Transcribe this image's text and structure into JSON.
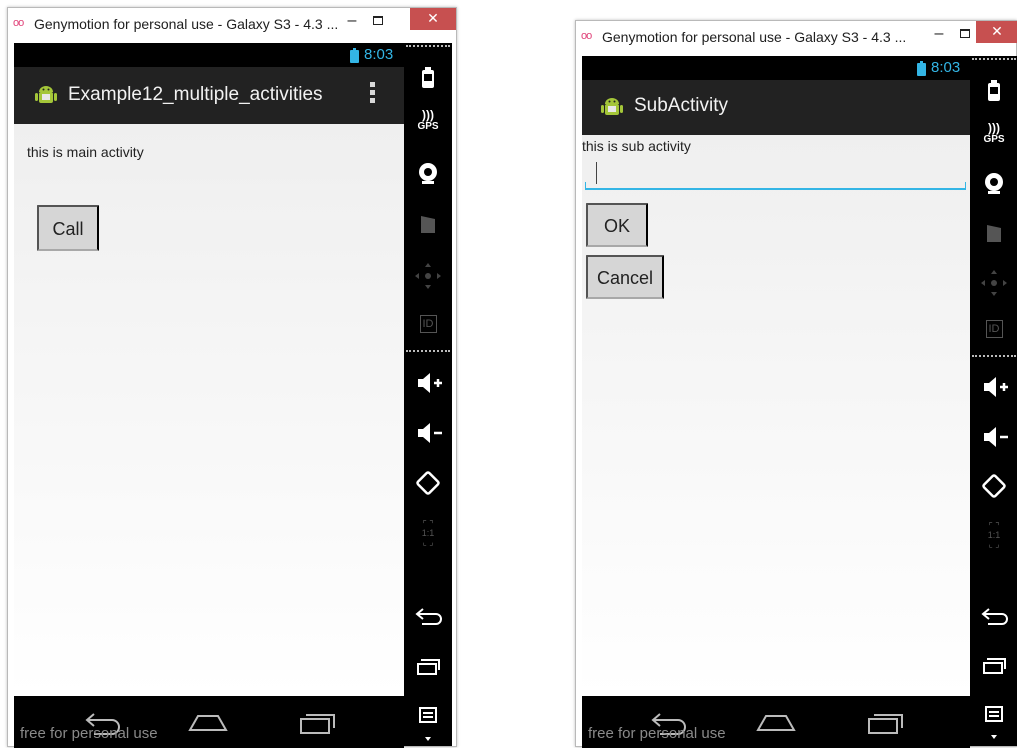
{
  "windows": [
    {
      "title": "Genymotion for personal use - Galaxy S3 - 4.3 ...",
      "title_logo": "oo",
      "minimize_symbol": "–",
      "close_symbol": "✕",
      "status_time": "8:03",
      "app_title": "Example12_multiple_activities",
      "content_label": "this is main activity",
      "buttons": [
        "Call"
      ],
      "watermark": "free for personal use"
    },
    {
      "title": "Genymotion for personal use - Galaxy S3 - 4.3 ...",
      "title_logo": "oo",
      "minimize_symbol": "–",
      "close_symbol": "✕",
      "status_time": "8:03",
      "app_title": "SubActivity",
      "content_label": "this is sub activity",
      "edit_value": "",
      "buttons": [
        "OK",
        "Cancel"
      ],
      "watermark": "free for personal use"
    }
  ],
  "toolbar_icons": [
    "battery-icon",
    "gps-icon",
    "webcam-icon",
    "movie-icon",
    "dpad-icon",
    "id-icon",
    "volume-up-icon",
    "volume-down-icon",
    "rotate-icon",
    "scale-icon",
    "back-icon",
    "recent-apps-icon",
    "menu-icon",
    "scroll-down-icon"
  ],
  "toolbar_labels": {
    "gps": "GPS",
    "id": "ID",
    "scale": "1:1"
  },
  "colors": {
    "accent": "#33b5e5",
    "close": "#c75050",
    "actionbar": "#222222",
    "android_green": "#a4c639"
  }
}
